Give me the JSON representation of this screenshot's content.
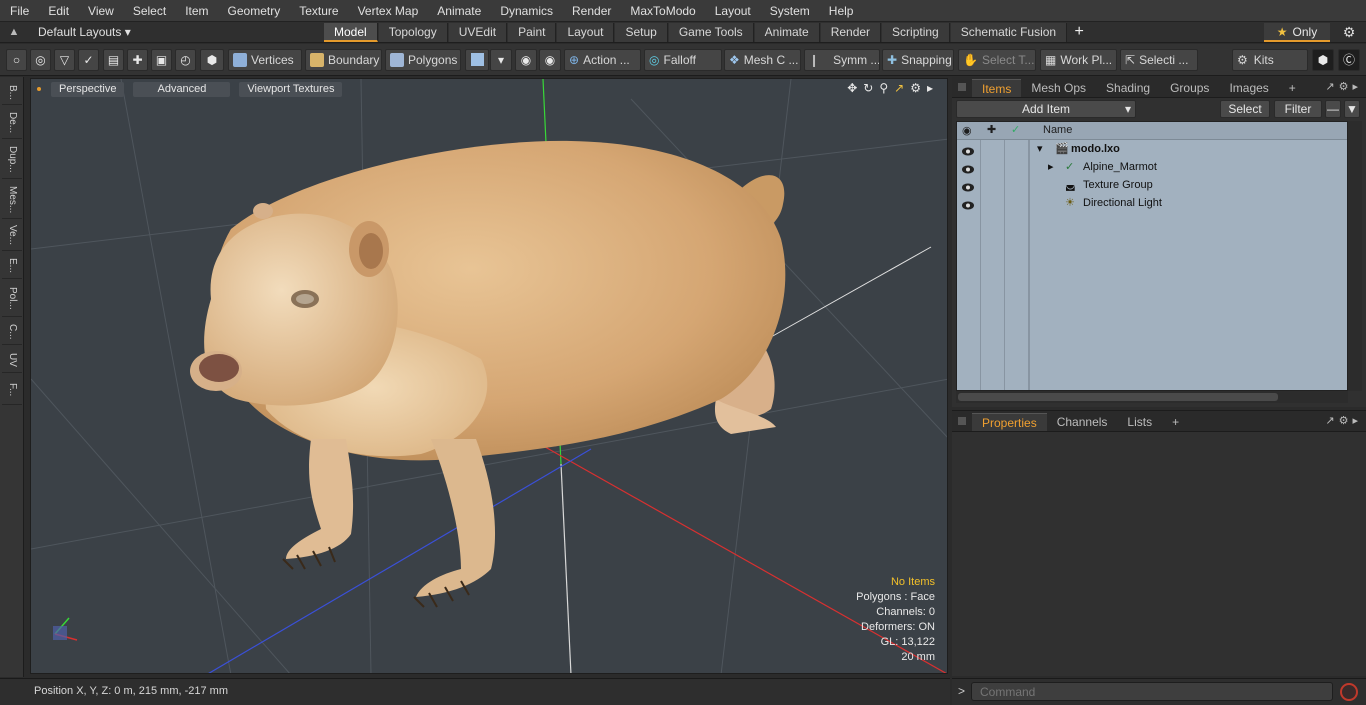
{
  "menu": [
    "File",
    "Edit",
    "View",
    "Select",
    "Item",
    "Geometry",
    "Texture",
    "Vertex Map",
    "Animate",
    "Dynamics",
    "Render",
    "MaxToModo",
    "Layout",
    "System",
    "Help"
  ],
  "layout_bar": {
    "layouts_label": "Default Layouts ▾",
    "tabs": [
      "Model",
      "Topology",
      "UVEdit",
      "Paint",
      "Layout",
      "Setup",
      "Game Tools",
      "Animate",
      "Render",
      "Scripting",
      "Schematic Fusion"
    ],
    "active_tab": "Model",
    "only_label": "Only"
  },
  "toolbar": {
    "vertices": "Vertices",
    "boundary": "Boundary",
    "polygons": "Polygons",
    "action": "Action ...",
    "falloff": "Falloff",
    "mesh": "Mesh C ...",
    "symmetry": "Symm ...",
    "snapping": "Snapping",
    "select_t": "Select T...",
    "work_plane": "Work Pl...",
    "selection": "Selecti ...",
    "kits": "Kits"
  },
  "left_tabs": [
    "B...",
    "De...",
    "Dup...",
    "Mes...",
    "Ve...",
    "E...",
    "Pol...",
    "C...",
    "UV",
    "F..."
  ],
  "viewport": {
    "view_mode": "Perspective",
    "shading": "Advanced",
    "textures": "Viewport Textures",
    "info": {
      "items": "No Items",
      "polygons": "Polygons : Face",
      "channels": "Channels: 0",
      "deformers": "Deformers: ON",
      "gl": "GL: 13,122",
      "scale": "20 mm"
    }
  },
  "status": {
    "position": "Position X, Y, Z:   0 m, 215 mm, -217 mm"
  },
  "items_panel": {
    "tabs": [
      "Items",
      "Mesh Ops",
      "Shading",
      "Groups",
      "Images"
    ],
    "active_tab": "Items",
    "add_item": "Add Item",
    "select": "Select",
    "filter": "Filter",
    "column_name": "Name",
    "tree": [
      {
        "label": "modo.lxo",
        "bold": true
      },
      {
        "label": "Alpine_Marmot",
        "bold": false
      },
      {
        "label": "Texture Group",
        "bold": false
      },
      {
        "label": "Directional Light",
        "bold": false
      }
    ]
  },
  "props_panel": {
    "tabs": [
      "Properties",
      "Channels",
      "Lists"
    ],
    "active_tab": "Properties"
  },
  "command": {
    "placeholder": "Command"
  },
  "colors": {
    "accent": "#e49a2c",
    "viewport_bg": "#3b4147",
    "tree_bg": "#a2b1bf",
    "marmot_body": "#d9ad7c"
  }
}
